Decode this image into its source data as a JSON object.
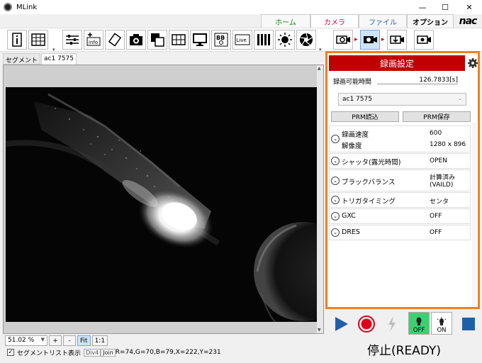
{
  "window": {
    "title": "MLink",
    "minimize": "—",
    "maximize": "☐",
    "close": "✕"
  },
  "menu": {
    "tabs": [
      "ホーム",
      "カメラ",
      "ファイル",
      "オプション"
    ],
    "active_tab": "カメラ",
    "brand": "nac"
  },
  "toolbar": {
    "left_icons": [
      "info-icon",
      "grid-icon"
    ],
    "middle_icons": [
      "sliders-icon",
      "add-info-icon",
      "rotate-icon",
      "camera-icon",
      "overlay-icon",
      "grid-overlay-icon",
      "monitor-icon",
      "bb-icon",
      "live-icon",
      "film-icon",
      "brightness-icon",
      "aperture-icon"
    ],
    "right_icons": [
      "camera-zoom-icon",
      "camera-capture-icon",
      "camera-download-icon",
      "camera-settings-icon"
    ]
  },
  "segments": {
    "label": "セグメント",
    "active": "ac1 7575"
  },
  "zoom": {
    "value": "51.02 %",
    "plus": "+",
    "minus": "-",
    "fit": "Fit",
    "one_to_one": "1:1"
  },
  "status": {
    "segment_list_label": "セグメントリスト表示",
    "checked": "✓",
    "div4": "Div4",
    "join": "Join",
    "pixel_info": "R=74,G=70,B=79,X=222,Y=231"
  },
  "panel": {
    "title": "録画設定",
    "rec_time_label": "録画可能時間",
    "rec_time_value": "126.7833[s]",
    "camera_select": "ac1 7575",
    "prm_read": "PRM読込",
    "prm_save": "PRM保存",
    "settings": [
      {
        "label": "録画速度",
        "value": "600",
        "label2": "解像度",
        "value2": "1280 x 896"
      },
      {
        "label": "シャッタ(露光時間)",
        "value": "OPEN"
      },
      {
        "label": "ブラックバランス",
        "value": "計算済み",
        "value2": "(VAILD)"
      },
      {
        "label": "トリガタイミング",
        "value": "センタ"
      },
      {
        "label": "GXC",
        "value": "OFF"
      },
      {
        "label": "DRES",
        "value": "OFF"
      }
    ]
  },
  "controls": {
    "led_off_label": "OFF",
    "led_on_label": "ON",
    "state": "停止(READY)",
    "colors": {
      "play": "#1f5fa8",
      "record": "#e0001a",
      "stop": "#1f5fa8",
      "led_active": "#3cd070"
    }
  }
}
